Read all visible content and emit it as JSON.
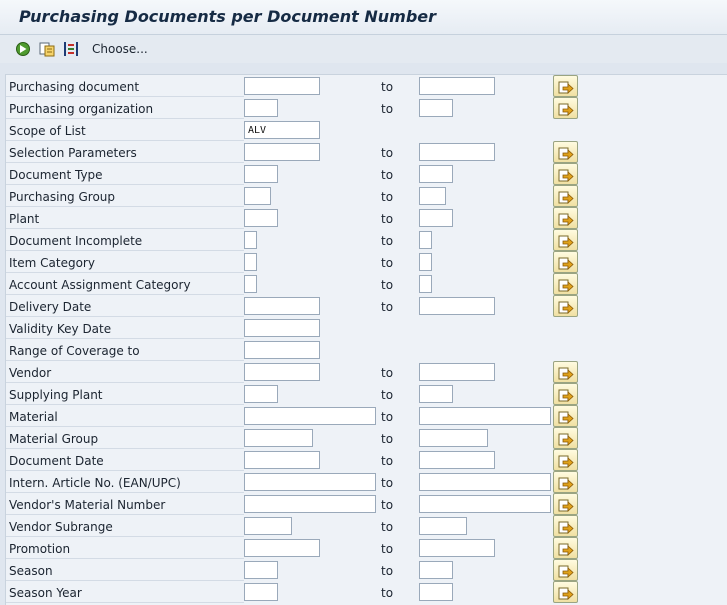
{
  "title": "Purchasing Documents per Document Number",
  "toolbar": {
    "execute_icon": "execute-icon",
    "variant_icon": "get-variant-icon",
    "select_icon": "selection-options-icon",
    "choose_label": "Choose..."
  },
  "to_label": "to",
  "fields": [
    {
      "label": "Purchasing document",
      "value": "",
      "to": true
    },
    {
      "label": "Purchasing organization",
      "value": "",
      "to": true
    },
    {
      "label": "Scope of List",
      "value": "ALV",
      "to": false
    },
    {
      "label": "Selection Parameters",
      "value": "",
      "to": true
    },
    {
      "label": "Document Type",
      "value": "",
      "to": true
    },
    {
      "label": "Purchasing Group",
      "value": "",
      "to": true
    },
    {
      "label": "Plant",
      "value": "",
      "to": true
    },
    {
      "label": "Document Incomplete",
      "value": "",
      "to": true
    },
    {
      "label": "Item Category",
      "value": "",
      "to": true
    },
    {
      "label": "Account Assignment Category",
      "value": "",
      "to": true
    },
    {
      "label": "Delivery Date",
      "value": "",
      "to": true
    },
    {
      "label": "Validity Key Date",
      "value": "",
      "to": false
    },
    {
      "label": "Range of Coverage to",
      "value": "",
      "to": false
    },
    {
      "label": "Vendor",
      "value": "",
      "to": true
    },
    {
      "label": "Supplying Plant",
      "value": "",
      "to": true
    },
    {
      "label": "Material",
      "value": "",
      "to": true
    },
    {
      "label": "Material Group",
      "value": "",
      "to": true
    },
    {
      "label": "Document Date",
      "value": "",
      "to": true
    },
    {
      "label": "Intern. Article No. (EAN/UPC)",
      "value": "",
      "to": true
    },
    {
      "label": "Vendor's Material Number",
      "value": "",
      "to": true
    },
    {
      "label": "Vendor Subrange",
      "value": "",
      "to": true
    },
    {
      "label": "Promotion",
      "value": "",
      "to": true
    },
    {
      "label": "Season",
      "value": "",
      "to": true
    },
    {
      "label": "Season Year",
      "value": "",
      "to": true
    }
  ],
  "colors": {
    "multi_select_button": "#f5e7a8",
    "arrow": "#e0a21c",
    "background": "#eef2f7"
  }
}
